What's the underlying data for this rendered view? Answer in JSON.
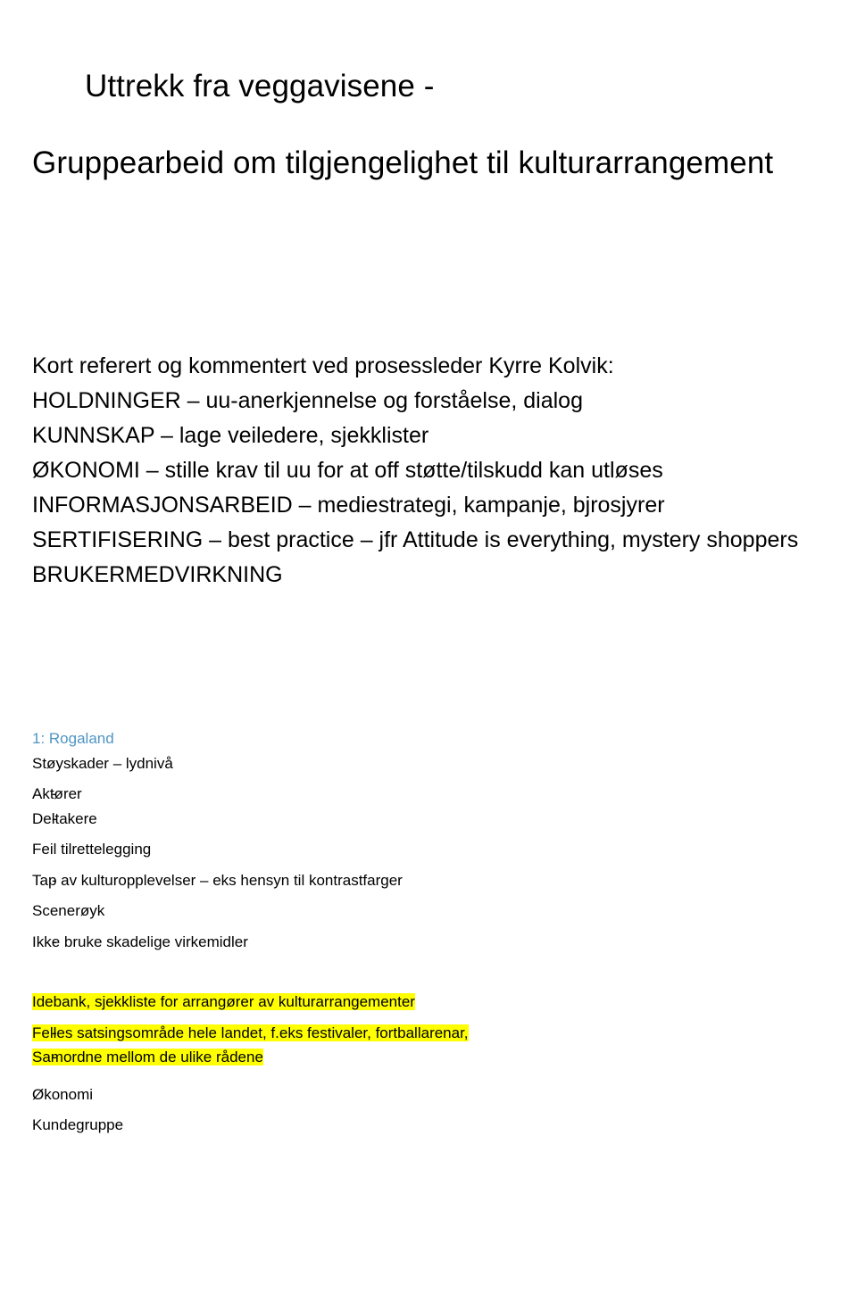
{
  "document": {
    "title_line1": "Uttrekk fra veggavisene -",
    "title_line2": "Gruppearbeid om tilgjengelighet til kulturarrangement",
    "intro": "Kort referert og kommentert ved prosessleder Kyrre Kolvik:",
    "topics": [
      "HOLDNINGER – uu-anerkjennelse og forståelse, dialog",
      "KUNNSKAP – lage veiledere, sjekklister",
      "ØKONOMI – stille krav til uu for at off støtte/tilskudd kan utløses",
      "INFORMASJONSARBEID – mediestrategi, kampanje, bjrosjyrer",
      "SERTIFISERING – best practice – jfr Attitude is everything, mystery shoppers",
      "BRUKERMEDVIRKNING"
    ],
    "group": {
      "heading": "1: Rogaland",
      "section1_title": "Støyskader – lydnivå",
      "section1_items": [
        "Aktører",
        "Deltakere"
      ],
      "section2_title": "Feil tilrettelegging",
      "section2_items": [
        "Tap av kulturopplevelser – eks hensyn til kontrastfarger"
      ],
      "section3_title": "Scenerøyk",
      "section3_items": [
        "Ikke bruke skadelige virkemidler"
      ],
      "highlight_heading": "Idebank, sjekkliste for arrangører av kulturarrangementer",
      "highlight_items": [
        "Felles satsingsområde hele landet, f.eks festivaler, fortballarenar,",
        "Samordne mellom de ulike rådene"
      ],
      "tail_items": [
        "Økonomi",
        "Kundegruppe"
      ]
    },
    "dash": "-"
  }
}
